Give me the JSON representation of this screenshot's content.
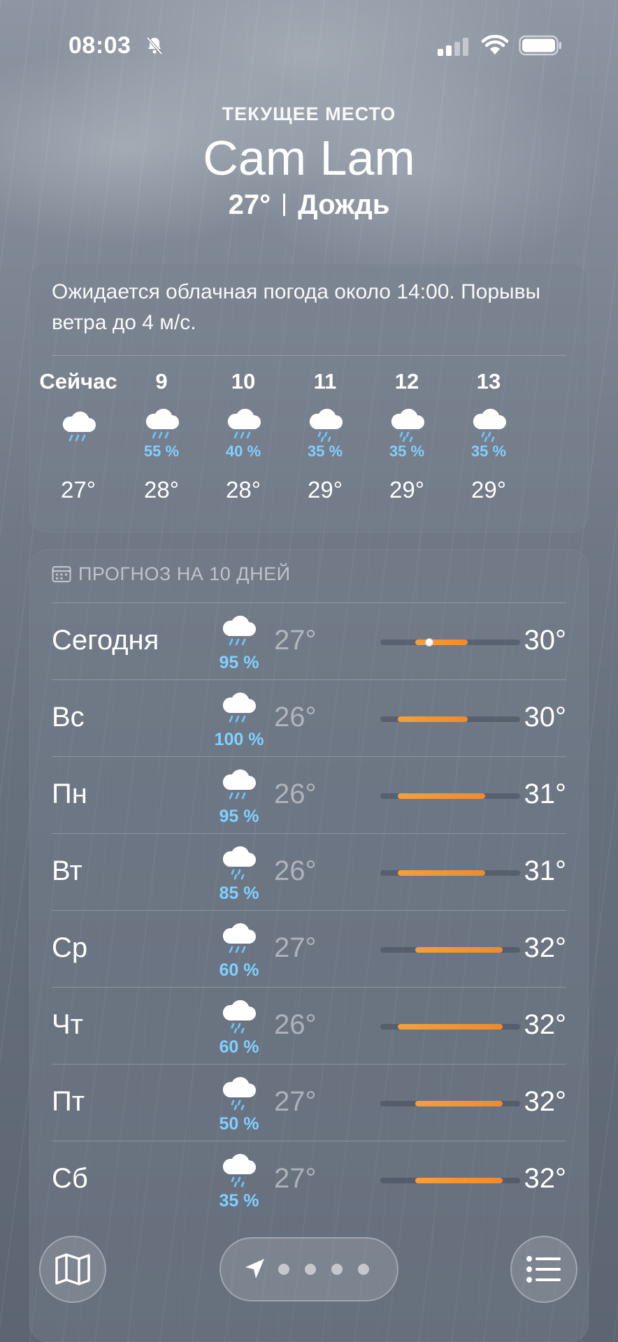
{
  "status": {
    "time": "08:03"
  },
  "header": {
    "location_label": "ТЕКУЩЕЕ МЕСТО",
    "city": "Cam Lam",
    "temp": "27°",
    "condition": "Дождь"
  },
  "hourly": {
    "summary": "Ожидается облачная погода около 14:00. Порывы ветра до 4 м/с.",
    "hours": [
      {
        "label": "Сейчас",
        "pop": "",
        "temp": "27°"
      },
      {
        "label": "9",
        "pop": "55 %",
        "temp": "28°"
      },
      {
        "label": "10",
        "pop": "40 %",
        "temp": "28°"
      },
      {
        "label": "11",
        "pop": "35 %",
        "temp": "29°"
      },
      {
        "label": "12",
        "pop": "35 %",
        "temp": "29°"
      },
      {
        "label": "13",
        "pop": "35 %",
        "temp": "29°"
      }
    ]
  },
  "daily": {
    "title": "ПРОГНОЗ НА 10 ДНЕЙ",
    "days": [
      {
        "day": "Сегодня",
        "pop": "95 %",
        "low": "27°",
        "high": "30°",
        "icon": "heavy-rain-icon",
        "range_lo": 27,
        "range_hi": 30,
        "current": 27
      },
      {
        "day": "Вс",
        "pop": "100 %",
        "low": "26°",
        "high": "30°",
        "icon": "heavy-rain-icon",
        "range_lo": 26,
        "range_hi": 30
      },
      {
        "day": "Пн",
        "pop": "95 %",
        "low": "26°",
        "high": "31°",
        "icon": "heavy-rain-icon",
        "range_lo": 26,
        "range_hi": 31
      },
      {
        "day": "Вт",
        "pop": "85 %",
        "low": "26°",
        "high": "31°",
        "icon": "rain-icon",
        "range_lo": 26,
        "range_hi": 31
      },
      {
        "day": "Ср",
        "pop": "60 %",
        "low": "27°",
        "high": "32°",
        "icon": "heavy-rain-icon",
        "range_lo": 27,
        "range_hi": 32
      },
      {
        "day": "Чт",
        "pop": "60 %",
        "low": "26°",
        "high": "32°",
        "icon": "rain-icon",
        "range_lo": 26,
        "range_hi": 32
      },
      {
        "day": "Пт",
        "pop": "50 %",
        "low": "27°",
        "high": "32°",
        "icon": "rain-icon",
        "range_lo": 27,
        "range_hi": 32
      },
      {
        "day": "Сб",
        "pop": "35 %",
        "low": "27°",
        "high": "32°",
        "icon": "rain-icon",
        "range_lo": 27,
        "range_hi": 32
      }
    ]
  },
  "colors": {
    "accent_pop": "#7fd0ff",
    "range_fill": "#ef8a2e"
  }
}
